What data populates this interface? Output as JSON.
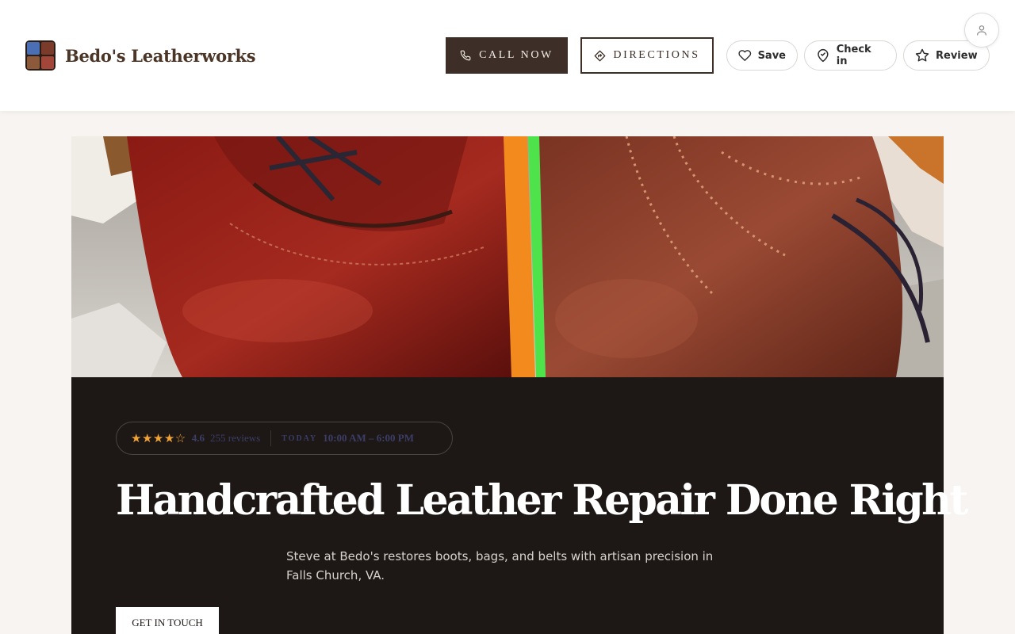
{
  "header": {
    "brand_name": "Bedo's Leatherworks",
    "call_label": "CALL NOW",
    "directions_label": "DIRECTIONS",
    "save_label": "Save",
    "checkin_label": "Check in",
    "review_label": "Review"
  },
  "hero": {
    "stars": "★★★★☆",
    "rating": "4.6",
    "review_count": "255 reviews",
    "today_label": "TODAY",
    "hours": "10:00 AM – 6:00 PM",
    "title": "Handcrafted Leather Repair Done Right",
    "subtitle": "Steve at Bedo's restores boots, bags, and belts with artisan precision in Falls Church, VA.",
    "cta_label": "GET IN TOUCH"
  },
  "colors": {
    "brand_dark": "#3d2f27",
    "panel_bg": "#1d1816",
    "star_color": "#f1a333"
  },
  "icons": [
    "phone-icon",
    "directions-icon",
    "heart-icon",
    "map-pin-icon",
    "star-icon",
    "user-icon"
  ]
}
